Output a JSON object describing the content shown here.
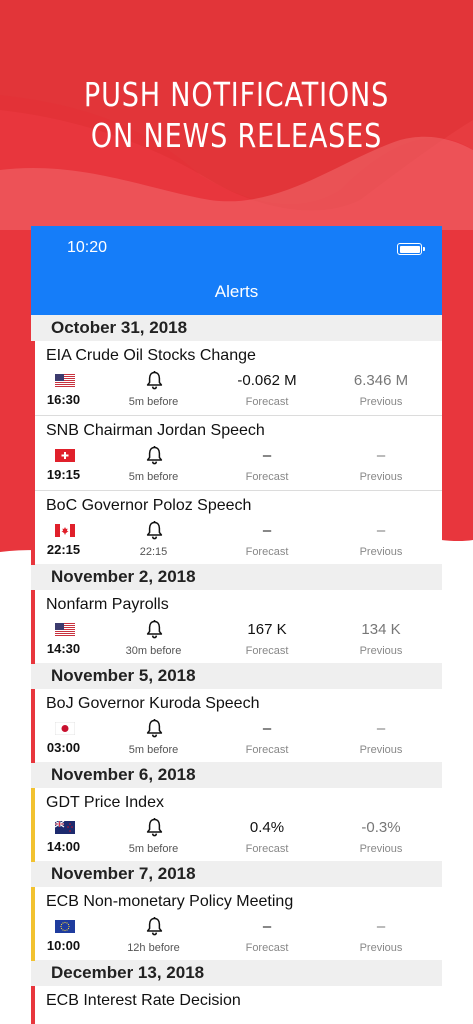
{
  "banner": {
    "line1": "PUSH NOTIFICATIONS",
    "line2": "ON NEWS RELEASES"
  },
  "status_bar": {
    "time": "10:20",
    "battery_icon": "battery-icon"
  },
  "nav": {
    "title": "Alerts"
  },
  "labels": {
    "forecast": "Forecast",
    "previous": "Previous"
  },
  "colors": {
    "red": "#e8363d",
    "blue": "#157df9",
    "yellow": "#f2c230"
  },
  "sections": [
    {
      "date": "October 31, 2018",
      "events": [
        {
          "name": "EIA Crude Oil Stocks Change",
          "flag": "us",
          "time": "16:30",
          "alert": "5m before",
          "forecast": "-0.062 M",
          "previous": "6.346 M",
          "importance": "high"
        },
        {
          "name": "SNB Chairman Jordan Speech",
          "flag": "ch",
          "time": "19:15",
          "alert": "5m before",
          "forecast": "–",
          "previous": "–",
          "importance": "high"
        },
        {
          "name": "BoC Governor Poloz Speech",
          "flag": "ca",
          "time": "22:15",
          "alert": "22:15",
          "forecast": "–",
          "previous": "–",
          "importance": "high"
        }
      ]
    },
    {
      "date": "November 2, 2018",
      "events": [
        {
          "name": "Nonfarm Payrolls",
          "flag": "us",
          "time": "14:30",
          "alert": "30m before",
          "forecast": "167 K",
          "previous": "134 K",
          "importance": "high"
        }
      ]
    },
    {
      "date": "November 5, 2018",
      "events": [
        {
          "name": "BoJ Governor Kuroda Speech",
          "flag": "jp",
          "time": "03:00",
          "alert": "5m before",
          "forecast": "–",
          "previous": "–",
          "importance": "high"
        }
      ]
    },
    {
      "date": "November 6, 2018",
      "events": [
        {
          "name": "GDT Price Index",
          "flag": "nz",
          "time": "14:00",
          "alert": "5m before",
          "forecast": "0.4%",
          "previous": "-0.3%",
          "importance": "medium"
        }
      ]
    },
    {
      "date": "November 7, 2018",
      "events": [
        {
          "name": "ECB Non-monetary Policy Meeting",
          "flag": "eu",
          "time": "10:00",
          "alert": "12h before",
          "forecast": "–",
          "previous": "–",
          "importance": "medium"
        }
      ]
    },
    {
      "date": "December 13, 2018",
      "events": [
        {
          "name": "ECB Interest Rate Decision",
          "importance": "high"
        }
      ]
    }
  ]
}
